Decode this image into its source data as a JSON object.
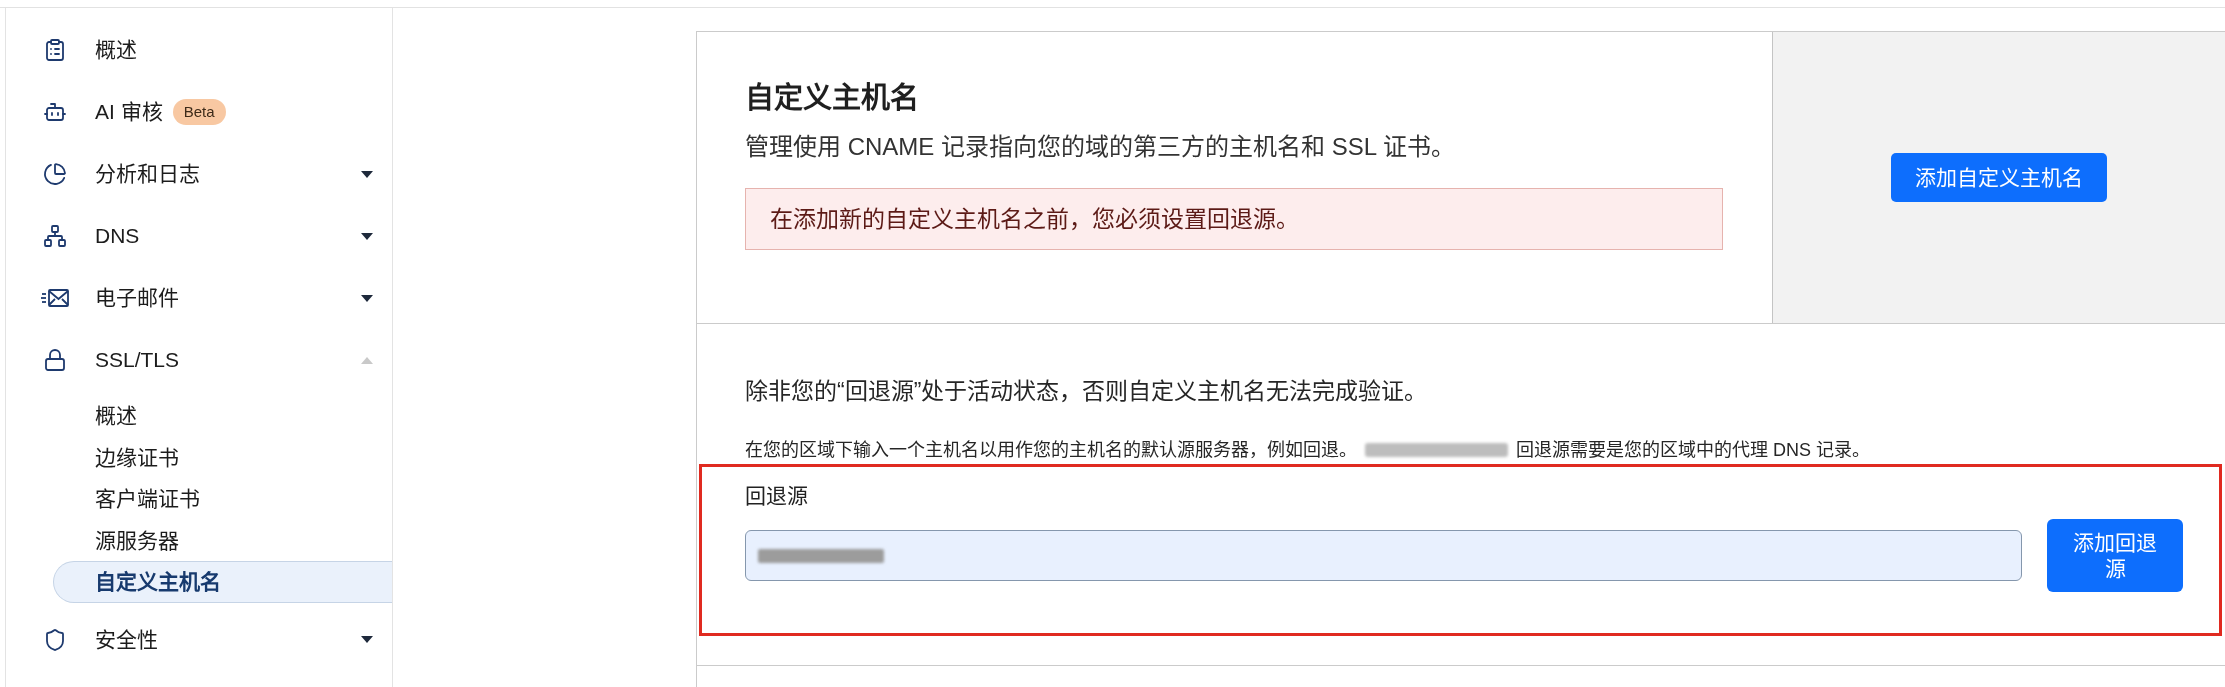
{
  "sidebar": {
    "items": [
      {
        "kind": "link",
        "label": "概述"
      },
      {
        "kind": "link",
        "label": "AI 审核",
        "badge": "Beta"
      },
      {
        "kind": "group",
        "label": "分析和日志",
        "expanded": false
      },
      {
        "kind": "group",
        "label": "DNS",
        "expanded": false
      },
      {
        "kind": "group",
        "label": "电子邮件",
        "expanded": false
      },
      {
        "kind": "group",
        "label": "SSL/TLS",
        "expanded": true,
        "children": [
          {
            "label": "概述",
            "selected": false
          },
          {
            "label": "边缘证书",
            "selected": false
          },
          {
            "label": "客户端证书",
            "selected": false
          },
          {
            "label": "源服务器",
            "selected": false
          },
          {
            "label": "自定义主机名",
            "selected": true
          }
        ]
      },
      {
        "kind": "group",
        "label": "安全性",
        "expanded": false
      }
    ]
  },
  "custom_hostnames": {
    "title": "自定义主机名",
    "description": "管理使用 CNAME 记录指向您的域的第三方的主机名和 SSL 证书。",
    "alert": "在添加新的自定义主机名之前，您必须设置回退源。",
    "add_button": "添加自定义主机名"
  },
  "fallback_origin": {
    "notice": "除非您的“回退源”处于活动状态，否则自定义主机名无法完成验证。",
    "help": [
      {
        "kind": "text",
        "text": "在您的区域下输入一个主机名以用作您的主机名的默认源服务器，例如回退。"
      },
      {
        "kind": "redacted"
      },
      {
        "kind": "text",
        "text": "回退源需要是您的区域中的代理 DNS 记录。"
      }
    ],
    "field": {
      "label": "回退源",
      "value": {
        "kind": "redacted"
      }
    },
    "button": "添加回退源"
  }
}
